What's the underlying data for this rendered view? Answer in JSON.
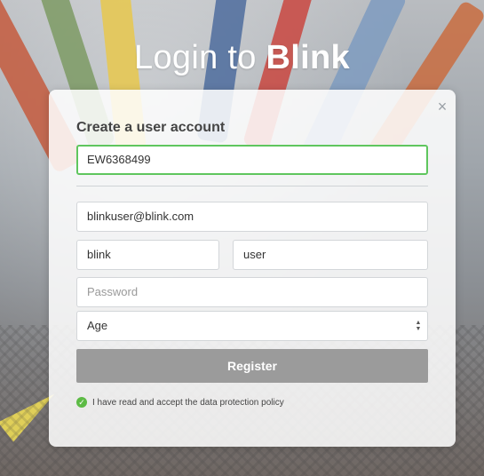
{
  "page": {
    "title_prefix": "Login to ",
    "title_brand": "Blink"
  },
  "dialog": {
    "close_icon": "×",
    "heading": "Create a user account",
    "fields": {
      "username_value": "EW6368499",
      "email_value": "blinkuser@blink.com",
      "first_name_value": "blink",
      "last_name_value": "user",
      "password_placeholder": "Password",
      "age_selected": "Age"
    },
    "register_label": "Register",
    "policy_text": "I have read and accept the data protection policy",
    "check_icon": "✓"
  },
  "colors": {
    "focus_border": "#5fc65e",
    "register_bg": "#9b9b9b",
    "check_green": "#5dbb45"
  }
}
